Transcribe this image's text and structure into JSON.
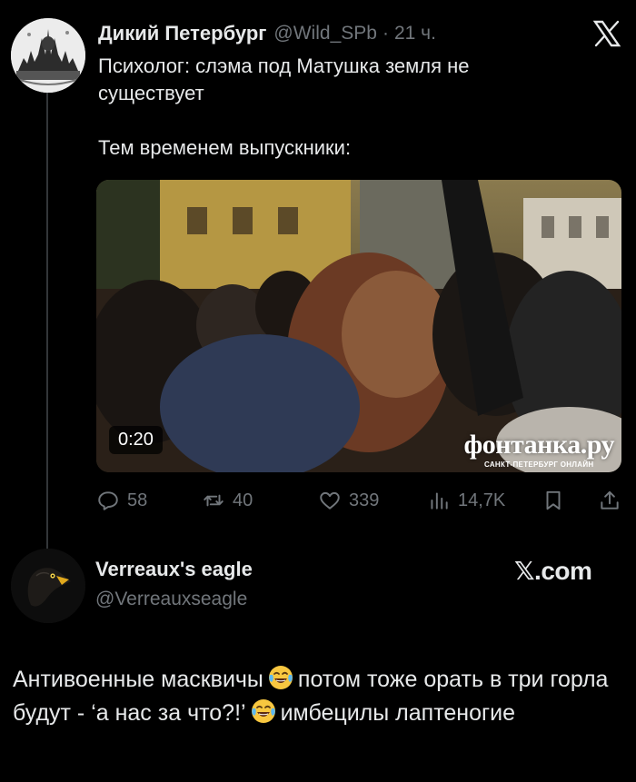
{
  "tweet": {
    "author_name": "Дикий Петербург",
    "author_handle": "@Wild_SPb",
    "separator": "·",
    "time": "21 ч.",
    "text_line1": "Психолог: слэма под Матушка земля не",
    "text_line2": "существует",
    "text_line3": "Тем временем выпускники:",
    "video_duration": "0:20",
    "watermark_main": "фонтанка.ру",
    "watermark_sub": "САНКТ-ПЕТЕРБУРГ ОНЛАЙН",
    "stats": {
      "replies": "58",
      "retweets": "40",
      "likes": "339",
      "views": "14,7K"
    }
  },
  "card": {
    "author_name": "Verreaux's eagle",
    "author_handle": "@Verreauxseagle",
    "brand": "𝕏.com",
    "text_part1": "Антивоенные масквичы",
    "text_part2": "потом тоже орать в три горла будут - ‘а нас за что?!’",
    "text_part3": "имбецилы лаптеногие"
  },
  "icons": [
    "x-logo-icon",
    "reply-icon",
    "retweet-icon",
    "like-icon",
    "views-icon",
    "bookmark-icon",
    "share-icon",
    "laughing-crying-emoji-icon"
  ],
  "colors": {
    "background": "#000000",
    "text": "#e7e9ea",
    "secondary_text": "#71767b",
    "thread_line": "#333639"
  }
}
